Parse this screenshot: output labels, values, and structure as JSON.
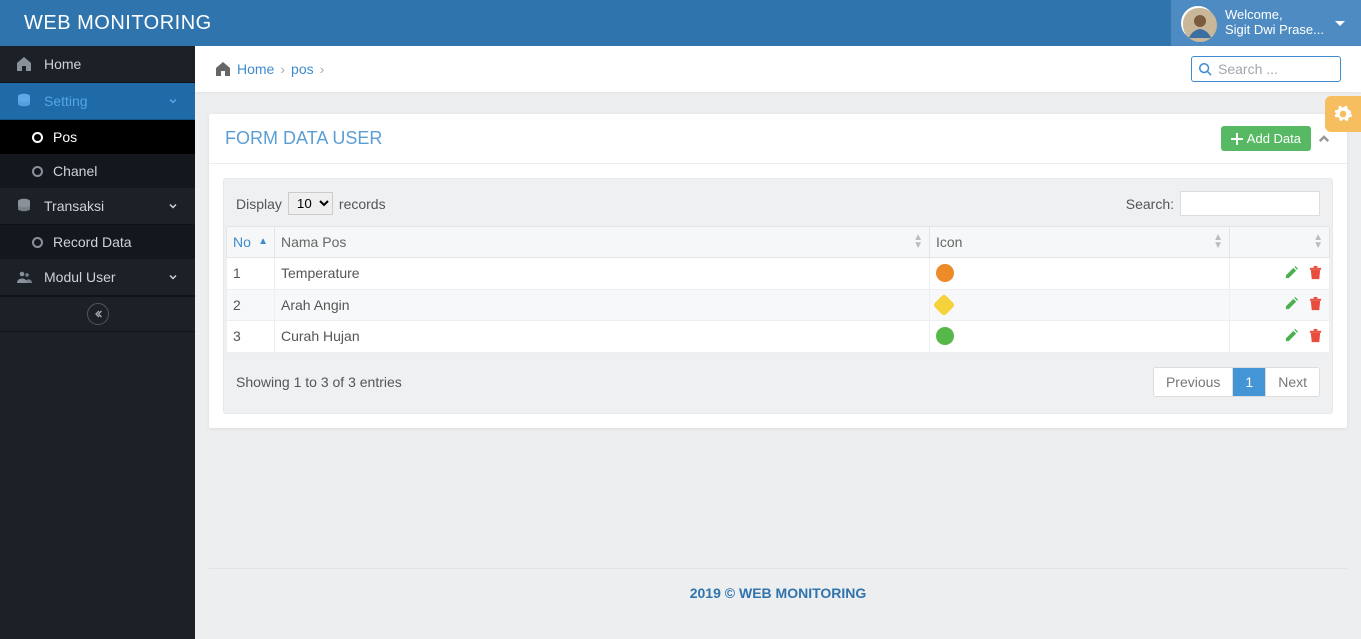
{
  "brand": "WEB MONITORING",
  "user": {
    "welcome": "Welcome,",
    "name": "Sigit Dwi Prase..."
  },
  "nav": {
    "home": "Home",
    "setting": "Setting",
    "pos": "Pos",
    "chanel": "Chanel",
    "transaksi": "Transaksi",
    "record_data": "Record Data",
    "modul_user": "Modul User"
  },
  "crumb": {
    "home": "Home",
    "pos": "pos"
  },
  "search_placeholder": "Search ...",
  "panel": {
    "title": "FORM DATA USER",
    "add_btn": "Add Data"
  },
  "dt": {
    "display": "Display",
    "records": "records",
    "page_size": "10",
    "search": "Search:",
    "cols": {
      "no": "No",
      "nama": "Nama Pos",
      "icon": "Icon"
    },
    "rows": [
      {
        "no": "1",
        "nama": "Temperature",
        "icon": "orange"
      },
      {
        "no": "2",
        "nama": "Arah Angin",
        "icon": "yellow"
      },
      {
        "no": "3",
        "nama": "Curah Hujan",
        "icon": "green"
      }
    ],
    "info": "Showing 1 to 3 of 3 entries",
    "prev": "Previous",
    "page": "1",
    "next": "Next"
  },
  "footer": "2019 © WEB MONITORING"
}
